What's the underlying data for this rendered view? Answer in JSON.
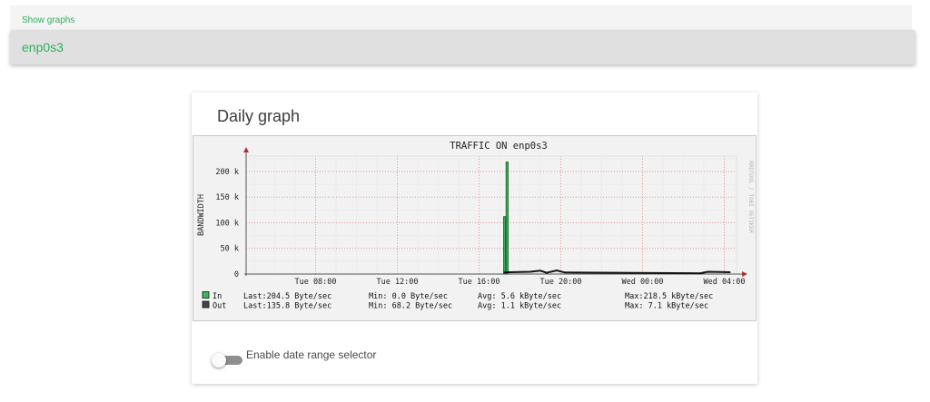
{
  "header": {
    "show_graphs_label": "Show graphs",
    "interface_name": "enp0s3"
  },
  "card": {
    "title": "Daily graph",
    "date_range_toggle_label": "Enable date range selector",
    "date_range_enabled": false
  },
  "chart_data": {
    "type": "area",
    "title": "TRAFFIC ON enp0s3",
    "ylabel": "BANDWIDTH",
    "side_label": "RRDTOOL / TOBI OETIKER",
    "yticks": [
      "0",
      "50 k",
      "100 k",
      "150 k",
      "200 k"
    ],
    "ytick_values": [
      0,
      50000,
      100000,
      150000,
      200000
    ],
    "ylim": [
      0,
      230000
    ],
    "xticks": [
      "Tue 08:00",
      "Tue 12:00",
      "Tue 16:00",
      "Tue 20:00",
      "Wed 00:00",
      "Wed 04:00"
    ],
    "x_hours": [
      8,
      12,
      16,
      20,
      24,
      28
    ],
    "xlim_hours": [
      4.6,
      28.6
    ],
    "grid": true,
    "series": [
      {
        "name": "In",
        "color": "#3cb760",
        "points": [
          [
            17.2,
            0
          ],
          [
            17.2,
            112000
          ],
          [
            17.28,
            112000
          ],
          [
            17.28,
            0
          ],
          [
            17.32,
            0
          ],
          [
            17.32,
            218500
          ],
          [
            17.42,
            218500
          ],
          [
            17.42,
            0
          ]
        ]
      },
      {
        "name": "Out",
        "color": "#444444",
        "points": [
          [
            17.2,
            3000
          ],
          [
            17.5,
            3500
          ],
          [
            18.5,
            4500
          ],
          [
            19.0,
            6500
          ],
          [
            19.3,
            2500
          ],
          [
            19.8,
            7100
          ],
          [
            20.2,
            3000
          ],
          [
            26.8,
            1500
          ],
          [
            27.2,
            4500
          ],
          [
            27.8,
            4000
          ],
          [
            28.3,
            3500
          ]
        ]
      }
    ],
    "legend": [
      {
        "name": "In",
        "color": "#3cb760",
        "last": "Last:204.5  Byte/sec",
        "min": "Min:  0.0  Byte/sec",
        "avg": "Avg:  5.6 kByte/sec",
        "max": "Max:218.5 kByte/sec"
      },
      {
        "name": "Out",
        "color": "#444444",
        "last": "Last:135.8  Byte/sec",
        "min": "Min: 68.2  Byte/sec",
        "avg": "Avg:  1.1 kByte/sec",
        "max": "Max:  7.1 kByte/sec"
      }
    ],
    "legend_placement": "bottom-left"
  }
}
